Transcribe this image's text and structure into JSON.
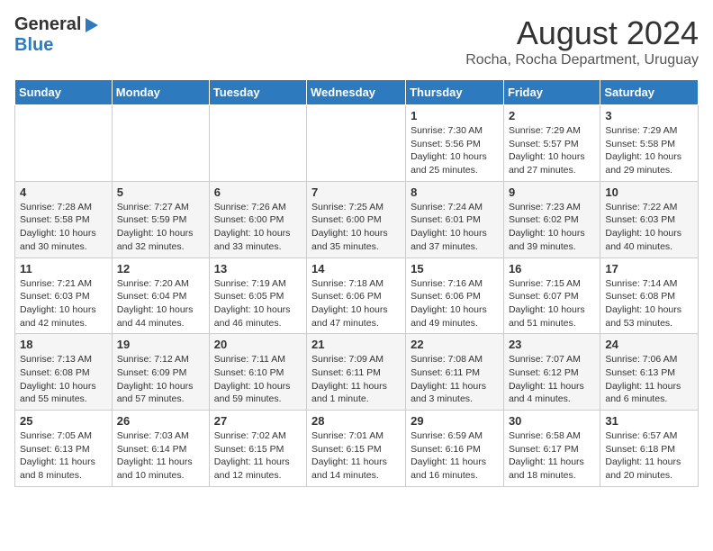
{
  "header": {
    "logo_general": "General",
    "logo_blue": "Blue",
    "month": "August 2024",
    "location": "Rocha, Rocha Department, Uruguay"
  },
  "weekdays": [
    "Sunday",
    "Monday",
    "Tuesday",
    "Wednesday",
    "Thursday",
    "Friday",
    "Saturday"
  ],
  "weeks": [
    [
      {
        "day": "",
        "info": ""
      },
      {
        "day": "",
        "info": ""
      },
      {
        "day": "",
        "info": ""
      },
      {
        "day": "",
        "info": ""
      },
      {
        "day": "1",
        "info": "Sunrise: 7:30 AM\nSunset: 5:56 PM\nDaylight: 10 hours\nand 25 minutes."
      },
      {
        "day": "2",
        "info": "Sunrise: 7:29 AM\nSunset: 5:57 PM\nDaylight: 10 hours\nand 27 minutes."
      },
      {
        "day": "3",
        "info": "Sunrise: 7:29 AM\nSunset: 5:58 PM\nDaylight: 10 hours\nand 29 minutes."
      }
    ],
    [
      {
        "day": "4",
        "info": "Sunrise: 7:28 AM\nSunset: 5:58 PM\nDaylight: 10 hours\nand 30 minutes."
      },
      {
        "day": "5",
        "info": "Sunrise: 7:27 AM\nSunset: 5:59 PM\nDaylight: 10 hours\nand 32 minutes."
      },
      {
        "day": "6",
        "info": "Sunrise: 7:26 AM\nSunset: 6:00 PM\nDaylight: 10 hours\nand 33 minutes."
      },
      {
        "day": "7",
        "info": "Sunrise: 7:25 AM\nSunset: 6:00 PM\nDaylight: 10 hours\nand 35 minutes."
      },
      {
        "day": "8",
        "info": "Sunrise: 7:24 AM\nSunset: 6:01 PM\nDaylight: 10 hours\nand 37 minutes."
      },
      {
        "day": "9",
        "info": "Sunrise: 7:23 AM\nSunset: 6:02 PM\nDaylight: 10 hours\nand 39 minutes."
      },
      {
        "day": "10",
        "info": "Sunrise: 7:22 AM\nSunset: 6:03 PM\nDaylight: 10 hours\nand 40 minutes."
      }
    ],
    [
      {
        "day": "11",
        "info": "Sunrise: 7:21 AM\nSunset: 6:03 PM\nDaylight: 10 hours\nand 42 minutes."
      },
      {
        "day": "12",
        "info": "Sunrise: 7:20 AM\nSunset: 6:04 PM\nDaylight: 10 hours\nand 44 minutes."
      },
      {
        "day": "13",
        "info": "Sunrise: 7:19 AM\nSunset: 6:05 PM\nDaylight: 10 hours\nand 46 minutes."
      },
      {
        "day": "14",
        "info": "Sunrise: 7:18 AM\nSunset: 6:06 PM\nDaylight: 10 hours\nand 47 minutes."
      },
      {
        "day": "15",
        "info": "Sunrise: 7:16 AM\nSunset: 6:06 PM\nDaylight: 10 hours\nand 49 minutes."
      },
      {
        "day": "16",
        "info": "Sunrise: 7:15 AM\nSunset: 6:07 PM\nDaylight: 10 hours\nand 51 minutes."
      },
      {
        "day": "17",
        "info": "Sunrise: 7:14 AM\nSunset: 6:08 PM\nDaylight: 10 hours\nand 53 minutes."
      }
    ],
    [
      {
        "day": "18",
        "info": "Sunrise: 7:13 AM\nSunset: 6:08 PM\nDaylight: 10 hours\nand 55 minutes."
      },
      {
        "day": "19",
        "info": "Sunrise: 7:12 AM\nSunset: 6:09 PM\nDaylight: 10 hours\nand 57 minutes."
      },
      {
        "day": "20",
        "info": "Sunrise: 7:11 AM\nSunset: 6:10 PM\nDaylight: 10 hours\nand 59 minutes."
      },
      {
        "day": "21",
        "info": "Sunrise: 7:09 AM\nSunset: 6:11 PM\nDaylight: 11 hours\nand 1 minute."
      },
      {
        "day": "22",
        "info": "Sunrise: 7:08 AM\nSunset: 6:11 PM\nDaylight: 11 hours\nand 3 minutes."
      },
      {
        "day": "23",
        "info": "Sunrise: 7:07 AM\nSunset: 6:12 PM\nDaylight: 11 hours\nand 4 minutes."
      },
      {
        "day": "24",
        "info": "Sunrise: 7:06 AM\nSunset: 6:13 PM\nDaylight: 11 hours\nand 6 minutes."
      }
    ],
    [
      {
        "day": "25",
        "info": "Sunrise: 7:05 AM\nSunset: 6:13 PM\nDaylight: 11 hours\nand 8 minutes."
      },
      {
        "day": "26",
        "info": "Sunrise: 7:03 AM\nSunset: 6:14 PM\nDaylight: 11 hours\nand 10 minutes."
      },
      {
        "day": "27",
        "info": "Sunrise: 7:02 AM\nSunset: 6:15 PM\nDaylight: 11 hours\nand 12 minutes."
      },
      {
        "day": "28",
        "info": "Sunrise: 7:01 AM\nSunset: 6:15 PM\nDaylight: 11 hours\nand 14 minutes."
      },
      {
        "day": "29",
        "info": "Sunrise: 6:59 AM\nSunset: 6:16 PM\nDaylight: 11 hours\nand 16 minutes."
      },
      {
        "day": "30",
        "info": "Sunrise: 6:58 AM\nSunset: 6:17 PM\nDaylight: 11 hours\nand 18 minutes."
      },
      {
        "day": "31",
        "info": "Sunrise: 6:57 AM\nSunset: 6:18 PM\nDaylight: 11 hours\nand 20 minutes."
      }
    ]
  ]
}
